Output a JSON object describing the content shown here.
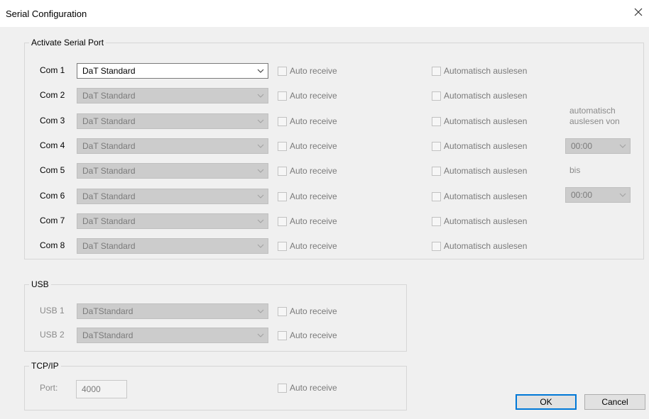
{
  "window": {
    "title": "Serial Configuration",
    "close_glyph": "✕"
  },
  "serial": {
    "group_label": "Activate Serial Port",
    "ports": [
      {
        "label": "Com 1",
        "protocol": "DaT Standard",
        "auto_receive": "Auto receive",
        "auto_read": "Automatisch auslesen",
        "enabled": true
      },
      {
        "label": "Com 2",
        "protocol": "DaT Standard",
        "auto_receive": "Auto receive",
        "auto_read": "Automatisch auslesen",
        "enabled": false
      },
      {
        "label": "Com 3",
        "protocol": "DaT Standard",
        "auto_receive": "Auto receive",
        "auto_read": "Automatisch auslesen",
        "enabled": false
      },
      {
        "label": "Com 4",
        "protocol": "DaT Standard",
        "auto_receive": "Auto receive",
        "auto_read": "Automatisch auslesen",
        "enabled": false
      },
      {
        "label": "Com 5",
        "protocol": "DaT Standard",
        "auto_receive": "Auto receive",
        "auto_read": "Automatisch auslesen",
        "enabled": false
      },
      {
        "label": "Com 6",
        "protocol": "DaT Standard",
        "auto_receive": "Auto receive",
        "auto_read": "Automatisch auslesen",
        "enabled": false
      },
      {
        "label": "Com 7",
        "protocol": "DaT Standard",
        "auto_receive": "Auto receive",
        "auto_read": "Automatisch auslesen",
        "enabled": false
      },
      {
        "label": "Com 8",
        "protocol": "DaT Standard",
        "auto_receive": "Auto receive",
        "auto_read": "Automatisch auslesen",
        "enabled": false
      }
    ],
    "schedule": {
      "label_line1": "automatisch",
      "label_line2": "auslesen von",
      "from_value": "00:00",
      "until_label": "bis",
      "to_value": "00:00"
    }
  },
  "usb": {
    "group_label": "USB",
    "ports": [
      {
        "label": "USB 1",
        "protocol": "DaTStandard",
        "auto_receive": "Auto receive"
      },
      {
        "label": "USB 2",
        "protocol": "DaTStandard",
        "auto_receive": "Auto receive"
      }
    ]
  },
  "tcp": {
    "group_label": "TCP/IP",
    "port_label": "Port:",
    "port_value": "4000",
    "auto_receive": "Auto receive"
  },
  "buttons": {
    "ok": "OK",
    "cancel": "Cancel"
  }
}
